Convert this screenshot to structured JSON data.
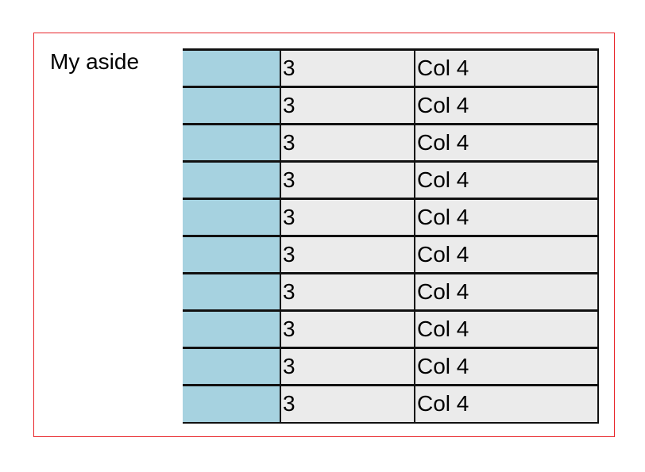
{
  "aside": {
    "text": "My aside"
  },
  "table": {
    "rows": [
      {
        "col1": "",
        "col3": "3",
        "col4": "Col 4"
      },
      {
        "col1": "",
        "col3": "3",
        "col4": "Col 4"
      },
      {
        "col1": "",
        "col3": "3",
        "col4": "Col 4"
      },
      {
        "col1": "",
        "col3": "3",
        "col4": "Col 4"
      },
      {
        "col1": "",
        "col3": "3",
        "col4": "Col 4"
      },
      {
        "col1": "",
        "col3": "3",
        "col4": "Col 4"
      },
      {
        "col1": "",
        "col3": "3",
        "col4": "Col 4"
      },
      {
        "col1": "",
        "col3": "3",
        "col4": "Col 4"
      },
      {
        "col1": "",
        "col3": "3",
        "col4": "Col 4"
      },
      {
        "col1": "",
        "col3": "3",
        "col4": "Col 4"
      }
    ]
  },
  "colors": {
    "border_accent": "#e8262b",
    "cell_blue": "#a6d2e0",
    "cell_gray": "#ebebeb"
  }
}
